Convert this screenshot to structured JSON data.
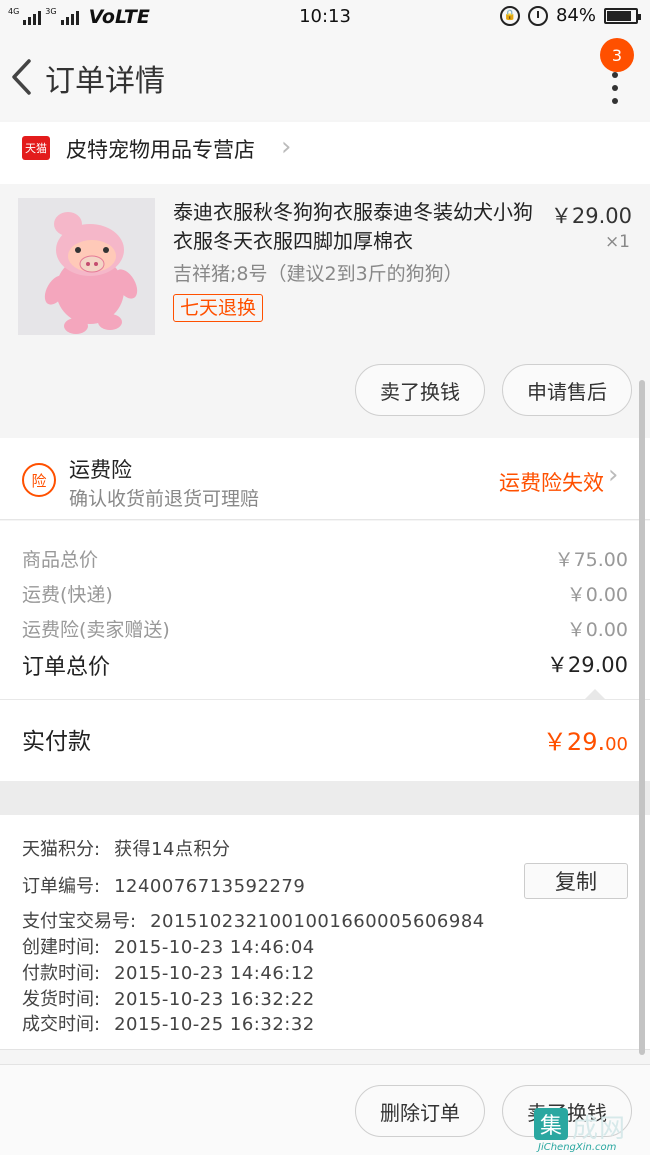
{
  "status_bar": {
    "net_top": "4G",
    "net_bottom": "3G",
    "volte": "VoLTE",
    "time": "10:13",
    "battery_pct": "84%",
    "battery_level": 0.84
  },
  "header": {
    "title": "订单详情",
    "badge_count": "3"
  },
  "shop": {
    "logo_text": "天猫",
    "name": "皮特宠物用品专营店"
  },
  "item": {
    "title": "泰迪衣服秋冬狗狗衣服泰迪冬装幼犬小狗衣服冬天衣服四脚加厚棉衣",
    "sku": "吉祥猪;8号（建议2到3斤的狗狗）",
    "return_tag": "七天退换",
    "price": "￥29.00",
    "qty": "×1",
    "actions": [
      "卖了换钱",
      "申请售后"
    ]
  },
  "insurance": {
    "icon_text": "险",
    "title": "运费险",
    "subtitle": "确认收货前退货可理赔",
    "status": "运费险失效"
  },
  "price_summary": {
    "rows": [
      {
        "label": "商品总价",
        "value": "￥75.00"
      },
      {
        "label": "运费(快递)",
        "value": "￥0.00"
      },
      {
        "label": "运费险(卖家赠送)",
        "value": "￥0.00"
      }
    ],
    "total_label": "订单总价",
    "total_value": "￥29.00",
    "paid_label": "实付款",
    "paid_value_main": "￥29.",
    "paid_value_cents": "00"
  },
  "order_info": {
    "points_label": "天猫积分:",
    "points_value": "获得14点积分",
    "order_no_label": "订单编号:",
    "order_no_value": "1240076713592279",
    "copy_label": "复制",
    "alipay_label": "支付宝交易号:",
    "alipay_value": "2015102321001001660005606984",
    "created_label": "创建时间:",
    "created_value": "2015-10-23 14:46:04",
    "paid_label": "付款时间:",
    "paid_value": "2015-10-23 14:46:12",
    "shipped_label": "发货时间:",
    "shipped_value": "2015-10-23 16:32:22",
    "done_label": "成交时间:",
    "done_value": "2015-10-25 16:32:32"
  },
  "footer": {
    "actions": [
      "删除订单",
      "卖了换钱"
    ]
  },
  "watermark": {
    "box": "集",
    "text": "成网",
    "url": "JiChengXin.com"
  }
}
